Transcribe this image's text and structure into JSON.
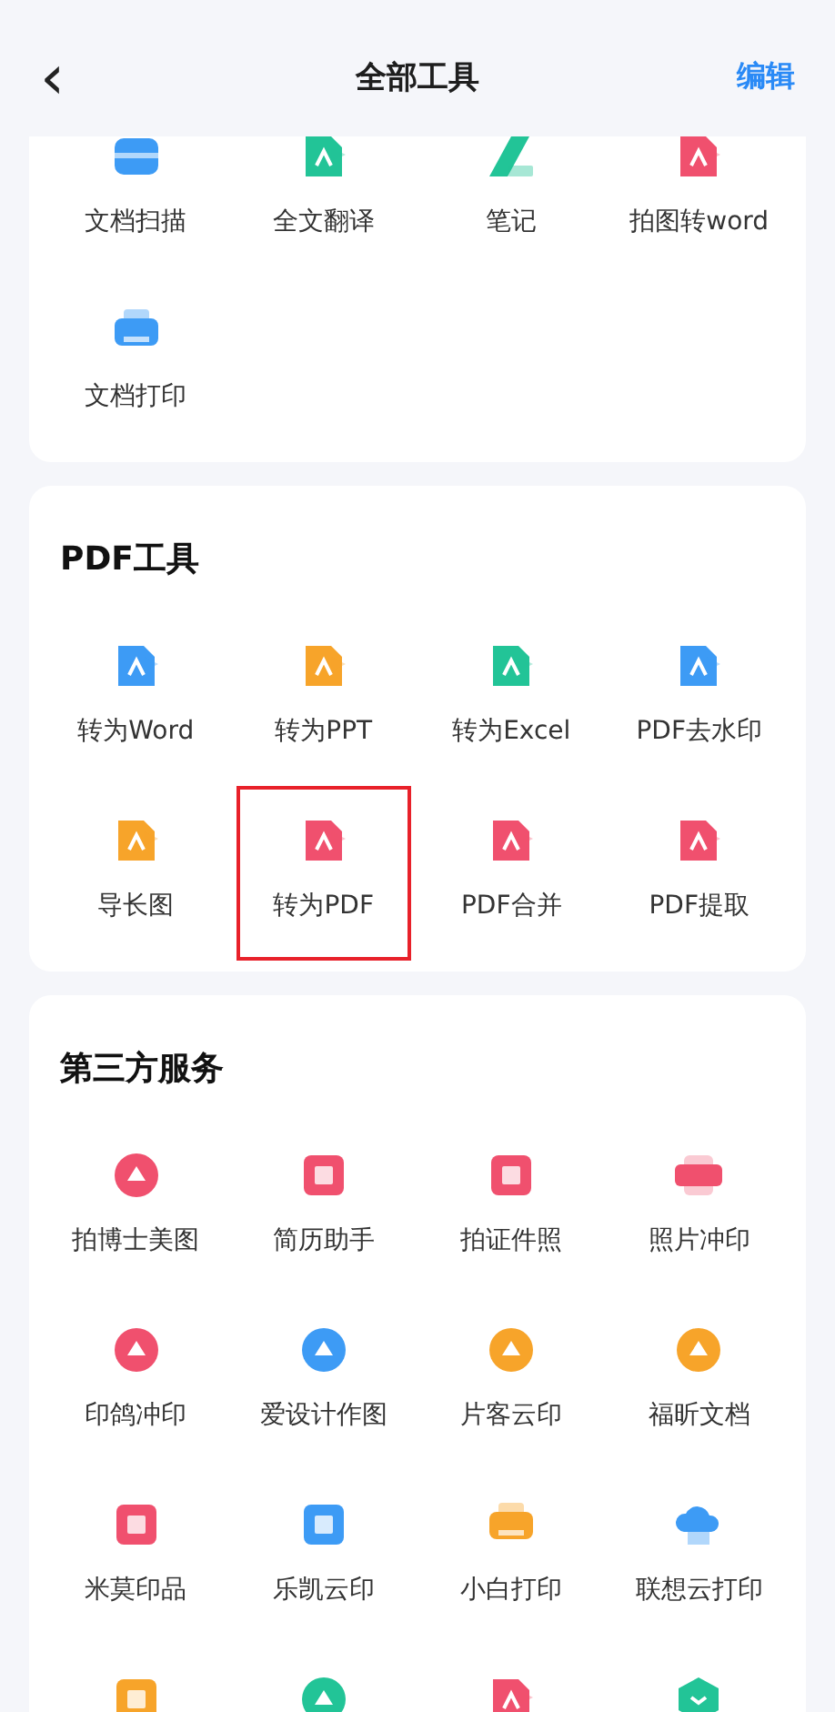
{
  "header": {
    "back": "‹",
    "title": "全部工具",
    "action": "编辑"
  },
  "sections": [
    {
      "tools": [
        {
          "label": "文档扫描",
          "kind": "scanner",
          "color": "#3d9bf5",
          "highlighted": false
        },
        {
          "label": "全文翻译",
          "kind": "document",
          "color": "#22c497",
          "highlighted": false
        },
        {
          "label": "笔记",
          "kind": "pen",
          "color": "#22c497",
          "highlighted": false
        },
        {
          "label": "拍图转word",
          "kind": "document",
          "color": "#f0506e",
          "highlighted": false
        },
        {
          "label": "文档打印",
          "kind": "printer",
          "color": "#3d9bf5",
          "highlighted": false
        }
      ]
    },
    {
      "title": "PDF工具",
      "tools": [
        {
          "label": "转为Word",
          "kind": "document",
          "color": "#3d9bf5",
          "highlighted": false
        },
        {
          "label": "转为PPT",
          "kind": "document",
          "color": "#f7a42a",
          "highlighted": false
        },
        {
          "label": "转为Excel",
          "kind": "document",
          "color": "#22c497",
          "highlighted": false
        },
        {
          "label": "PDF去水印",
          "kind": "document",
          "color": "#3d9bf5",
          "highlighted": false
        },
        {
          "label": "导长图",
          "kind": "document",
          "color": "#f7a42a",
          "highlighted": false
        },
        {
          "label": "转为PDF",
          "kind": "document",
          "color": "#f0506e",
          "highlighted": true
        },
        {
          "label": "PDF合并",
          "kind": "document",
          "color": "#f0506e",
          "highlighted": false
        },
        {
          "label": "PDF提取",
          "kind": "document",
          "color": "#f0506e",
          "highlighted": false
        }
      ]
    },
    {
      "title": "第三方服务",
      "tools": [
        {
          "label": "拍博士美图",
          "kind": "circle",
          "color": "#f0506e",
          "highlighted": false
        },
        {
          "label": "简历助手",
          "kind": "square",
          "color": "#f0506e",
          "highlighted": false
        },
        {
          "label": "拍证件照",
          "kind": "square",
          "color": "#f0506e",
          "highlighted": false
        },
        {
          "label": "照片冲印",
          "kind": "wide",
          "color": "#f0506e",
          "highlighted": false
        },
        {
          "label": "印鸽冲印",
          "kind": "circle",
          "color": "#f0506e",
          "highlighted": false
        },
        {
          "label": "爱设计作图",
          "kind": "circle",
          "color": "#3d9bf5",
          "highlighted": false
        },
        {
          "label": "片客云印",
          "kind": "circle",
          "color": "#f7a42a",
          "highlighted": false
        },
        {
          "label": "福昕文档",
          "kind": "circle",
          "color": "#f7a42a",
          "highlighted": false
        },
        {
          "label": "米莫印品",
          "kind": "square",
          "color": "#f0506e",
          "highlighted": false
        },
        {
          "label": "乐凯云印",
          "kind": "square",
          "color": "#3d9bf5",
          "highlighted": false
        },
        {
          "label": "小白打印",
          "kind": "printer",
          "color": "#f7a42a",
          "highlighted": false
        },
        {
          "label": "联想云打印",
          "kind": "cloud",
          "color": "#3d9bf5",
          "highlighted": false
        },
        {
          "kind": "square",
          "color": "#f7a42a",
          "highlighted": false
        },
        {
          "kind": "circle",
          "color": "#22c497",
          "highlighted": false
        },
        {
          "kind": "document",
          "color": "#f0506e",
          "highlighted": false
        },
        {
          "kind": "hexagon",
          "color": "#22c497",
          "highlighted": false
        }
      ]
    }
  ]
}
